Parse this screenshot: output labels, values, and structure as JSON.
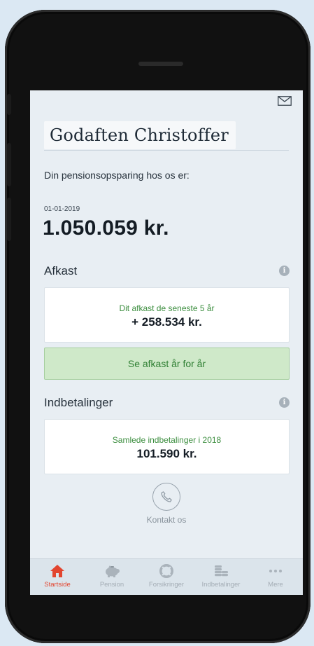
{
  "header": {
    "greeting": "Godaften Christoffer"
  },
  "summary": {
    "intro": "Din pensionsopsparing hos os er:",
    "date": "01-01-2019",
    "amount": "1.050.059 kr."
  },
  "afkast": {
    "title": "Afkast",
    "card_label": "Dit afkast de seneste 5 år",
    "card_value": "+ 258.534 kr.",
    "button_label": "Se afkast år for år"
  },
  "indbetalinger": {
    "title": "Indbetalinger",
    "card_label": "Samlede indbetalinger i 2018",
    "card_value": "101.590 kr."
  },
  "contact": {
    "label": "Kontakt os"
  },
  "tabs": [
    {
      "label": "Startside",
      "icon": "home-icon",
      "active": true
    },
    {
      "label": "Pension",
      "icon": "piggy-bank-icon",
      "active": false
    },
    {
      "label": "Forsikringer",
      "icon": "lifebuoy-icon",
      "active": false
    },
    {
      "label": "Indbetalinger",
      "icon": "coins-icon",
      "active": false
    },
    {
      "label": "Mere",
      "icon": "more-icon",
      "active": false
    }
  ],
  "colors": {
    "accent_green": "#3c8e3f",
    "button_green_bg": "#cfe9c9",
    "active_tab": "#e2452f",
    "screen_bg": "#e8eef3"
  }
}
